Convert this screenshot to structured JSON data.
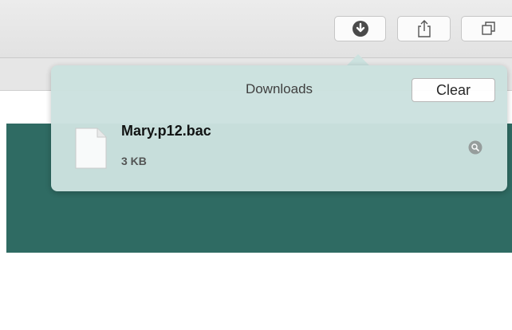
{
  "toolbar": {
    "buttons": [
      {
        "name": "downloads",
        "icon": "download-icon"
      },
      {
        "name": "share",
        "icon": "share-icon"
      },
      {
        "name": "tabs",
        "icon": "tab-overview-icon"
      }
    ]
  },
  "downloads_popover": {
    "title": "Downloads",
    "clear_label": "Clear",
    "items": [
      {
        "file_name": "Mary.p12.bac",
        "size": "3 KB",
        "icon": "file-icon",
        "action_icon": "magnifier-icon"
      }
    ]
  },
  "colors": {
    "page_accent": "#2f6b63",
    "popover_bg": "#cce2df"
  }
}
